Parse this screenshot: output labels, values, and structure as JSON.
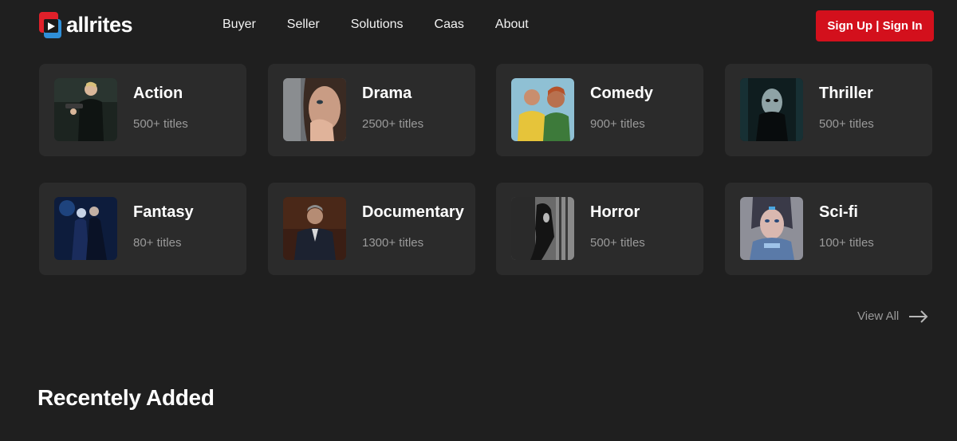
{
  "header": {
    "logo_text": "allrites",
    "nav": [
      "Buyer",
      "Seller",
      "Solutions",
      "Caas",
      "About"
    ],
    "auth_button": "Sign Up | Sign In",
    "accent_color": "#d3101c"
  },
  "genres": [
    {
      "title": "Action",
      "count": "500+ titles",
      "thumb": "action-thumbnail"
    },
    {
      "title": "Drama",
      "count": "2500+ titles",
      "thumb": "drama-thumbnail"
    },
    {
      "title": "Comedy",
      "count": "900+ titles",
      "thumb": "comedy-thumbnail"
    },
    {
      "title": "Thriller",
      "count": "500+ titles",
      "thumb": "thriller-thumbnail"
    },
    {
      "title": "Fantasy",
      "count": "80+ titles",
      "thumb": "fantasy-thumbnail"
    },
    {
      "title": "Documentary",
      "count": "1300+ titles",
      "thumb": "documentary-thumbnail"
    },
    {
      "title": "Horror",
      "count": "500+ titles",
      "thumb": "horror-thumbnail"
    },
    {
      "title": "Sci-fi",
      "count": "100+ titles",
      "thumb": "scifi-thumbnail"
    }
  ],
  "view_all": "View All",
  "section_title": "Recentely Added"
}
